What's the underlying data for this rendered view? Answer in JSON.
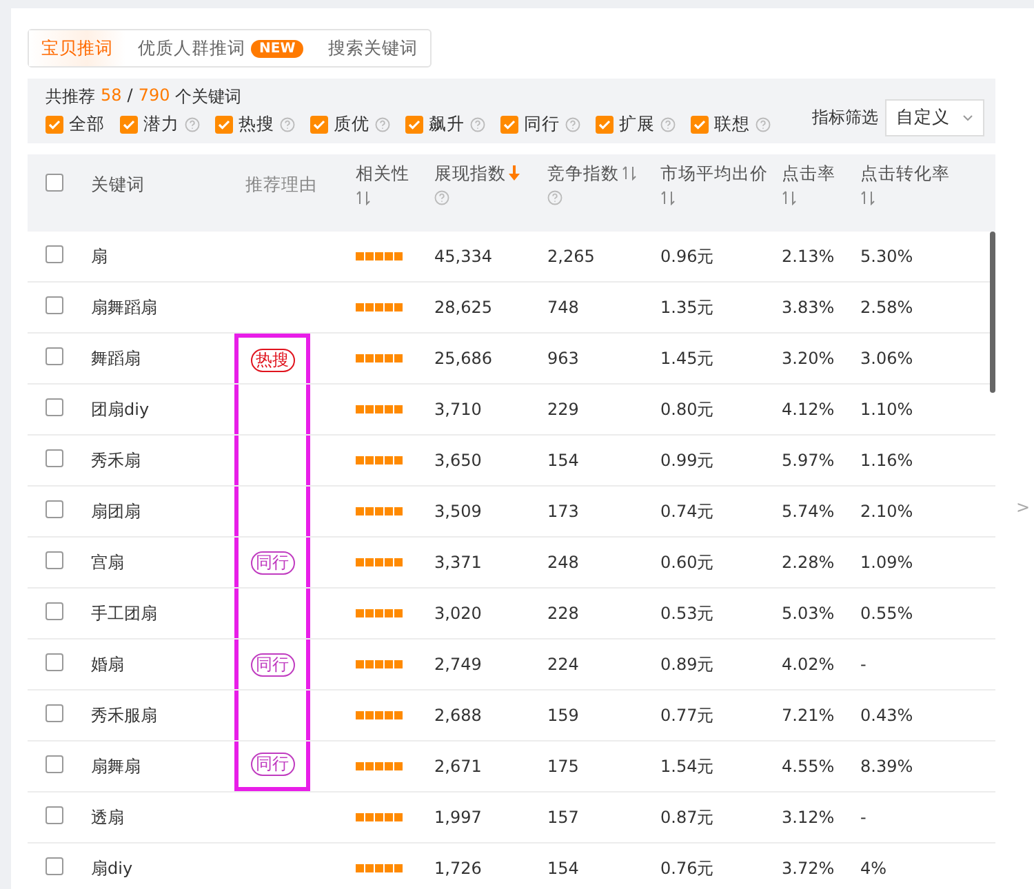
{
  "tabs": [
    {
      "label": "宝贝推词",
      "selected": true
    },
    {
      "label": "优质人群推词",
      "badge": "NEW",
      "selected": false
    },
    {
      "label": "搜索关键词",
      "selected": false
    }
  ],
  "summary": {
    "prefix": "共推荐",
    "count": "58",
    "separator": "/",
    "total": "790",
    "suffix": "个关键词"
  },
  "filters": [
    {
      "label": "全部",
      "checked": true,
      "help": false
    },
    {
      "label": "潜力",
      "checked": true,
      "help": true
    },
    {
      "label": "热搜",
      "checked": true,
      "help": true
    },
    {
      "label": "质优",
      "checked": true,
      "help": true
    },
    {
      "label": "飙升",
      "checked": true,
      "help": true
    },
    {
      "label": "同行",
      "checked": true,
      "help": true
    },
    {
      "label": "扩展",
      "checked": true,
      "help": true
    },
    {
      "label": "联想",
      "checked": true,
      "help": true
    }
  ],
  "metric_filter": {
    "label": "指标筛选",
    "value": "自定义"
  },
  "table": {
    "select_all": {
      "checked": false
    },
    "columns": [
      {
        "label": "关键词",
        "sortable": false,
        "help": false,
        "muted": false
      },
      {
        "label": "推荐理由",
        "sortable": false,
        "help": false,
        "muted": true
      },
      {
        "label": "相关性",
        "sortable": true,
        "sorted_descending": false,
        "help": false,
        "muted": false
      },
      {
        "label": "展现指数",
        "sortable": true,
        "sorted_descending": true,
        "help": true,
        "muted": false
      },
      {
        "label": "竞争指数",
        "sortable": true,
        "sorted_descending": false,
        "help": true,
        "muted": false
      },
      {
        "label": "市场平均出价",
        "sortable": true,
        "sorted_descending": false,
        "help": false,
        "muted": false
      },
      {
        "label": "点击率",
        "sortable": true,
        "sorted_descending": false,
        "help": false,
        "muted": false
      },
      {
        "label": "点击转化率",
        "sortable": true,
        "sorted_descending": false,
        "help": false,
        "muted": false
      }
    ],
    "rows": [
      {
        "checked": false,
        "keyword": "扇",
        "highlighted": false,
        "stars": 5,
        "impressions": "45,334",
        "competition": "2,265",
        "price": "0.96元",
        "ctr": "2.13%",
        "cvr": "5.30%"
      },
      {
        "checked": false,
        "keyword": "扇舞蹈扇",
        "highlighted": false,
        "stars": 5,
        "impressions": "28,625",
        "competition": "748",
        "price": "1.35元",
        "ctr": "3.83%",
        "cvr": "2.58%"
      },
      {
        "checked": false,
        "keyword": "舞蹈扇",
        "highlighted": true,
        "reason": {
          "label": "热搜",
          "kind": "hot"
        },
        "stars": 5,
        "impressions": "25,686",
        "competition": "963",
        "price": "1.45元",
        "ctr": "3.20%",
        "cvr": "3.06%"
      },
      {
        "checked": false,
        "keyword": "团扇diy",
        "highlighted": true,
        "stars": 5,
        "impressions": "3,710",
        "competition": "229",
        "price": "0.80元",
        "ctr": "4.12%",
        "cvr": "1.10%"
      },
      {
        "checked": false,
        "keyword": "秀禾扇",
        "highlighted": true,
        "stars": 5,
        "impressions": "3,650",
        "competition": "154",
        "price": "0.99元",
        "ctr": "5.97%",
        "cvr": "1.16%"
      },
      {
        "checked": false,
        "keyword": "扇团扇",
        "highlighted": true,
        "stars": 5,
        "impressions": "3,509",
        "competition": "173",
        "price": "0.74元",
        "ctr": "5.74%",
        "cvr": "2.10%"
      },
      {
        "checked": false,
        "keyword": "宫扇",
        "highlighted": true,
        "reason": {
          "label": "同行",
          "kind": "peer"
        },
        "stars": 5,
        "impressions": "3,371",
        "competition": "248",
        "price": "0.60元",
        "ctr": "2.28%",
        "cvr": "1.09%"
      },
      {
        "checked": false,
        "keyword": "手工团扇",
        "highlighted": true,
        "stars": 5,
        "impressions": "3,020",
        "competition": "228",
        "price": "0.53元",
        "ctr": "5.03%",
        "cvr": "0.55%"
      },
      {
        "checked": false,
        "keyword": "婚扇",
        "highlighted": true,
        "reason": {
          "label": "同行",
          "kind": "peer"
        },
        "stars": 5,
        "impressions": "2,749",
        "competition": "224",
        "price": "0.89元",
        "ctr": "4.02%",
        "cvr": "-"
      },
      {
        "checked": false,
        "keyword": "秀禾服扇",
        "highlighted": true,
        "stars": 5,
        "impressions": "2,688",
        "competition": "159",
        "price": "0.77元",
        "ctr": "7.21%",
        "cvr": "0.43%"
      },
      {
        "checked": false,
        "keyword": "扇舞扇",
        "highlighted": true,
        "reason": {
          "label": "同行",
          "kind": "peer"
        },
        "stars": 5,
        "impressions": "2,671",
        "competition": "175",
        "price": "1.54元",
        "ctr": "4.55%",
        "cvr": "8.39%"
      },
      {
        "checked": false,
        "keyword": "透扇",
        "highlighted": false,
        "stars": 5,
        "impressions": "1,997",
        "competition": "157",
        "price": "0.87元",
        "ctr": "3.12%",
        "cvr": "-"
      },
      {
        "checked": false,
        "keyword": "扇diy",
        "highlighted": false,
        "stars": 5,
        "impressions": "1,726",
        "competition": "154",
        "price": "0.76元",
        "ctr": "3.72%",
        "cvr": "4%"
      }
    ]
  },
  "side_toggle": ">"
}
